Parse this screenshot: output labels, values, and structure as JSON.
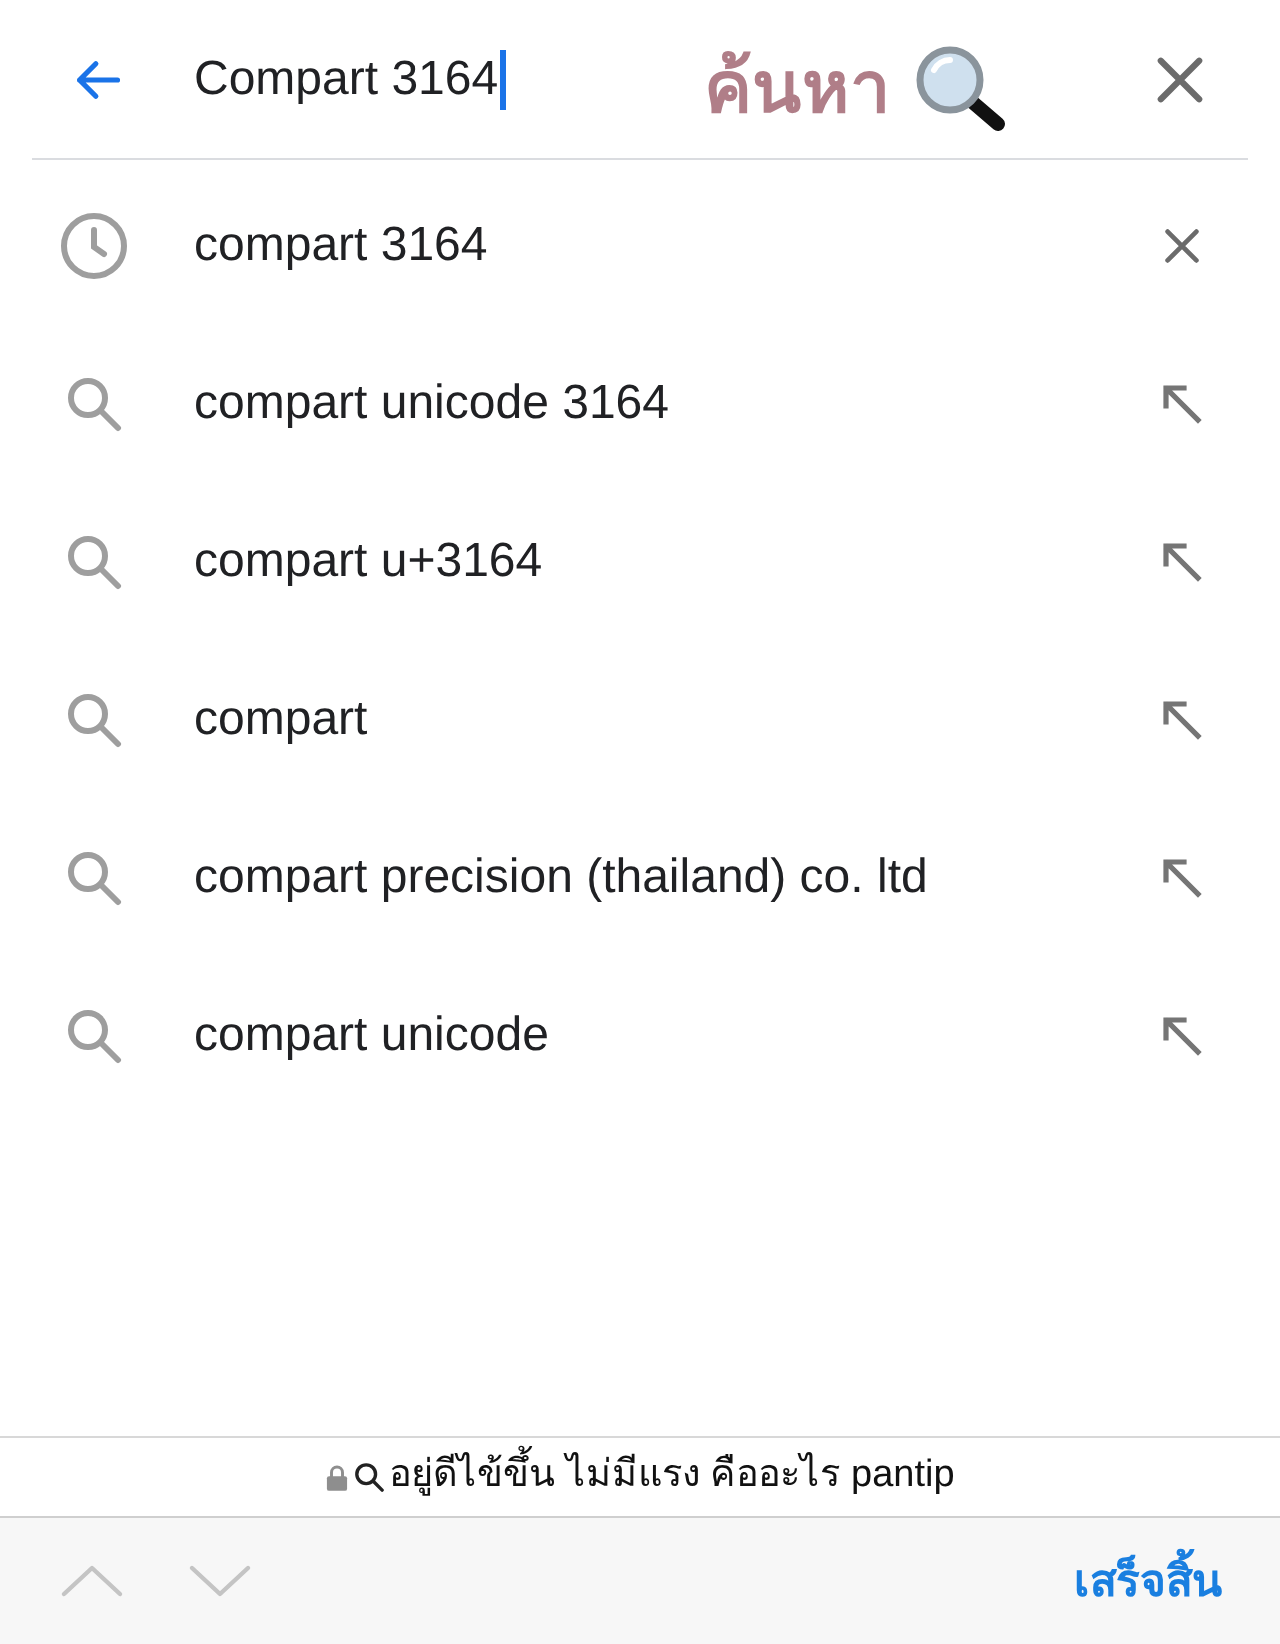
{
  "search_bar": {
    "value": "Compart 3164",
    "annotation": "ค้นหา"
  },
  "suggestions": [
    {
      "kind": "history",
      "text": "compart 3164"
    },
    {
      "kind": "suggestion",
      "text": "compart unicode 3164"
    },
    {
      "kind": "suggestion",
      "text": "compart u+3164"
    },
    {
      "kind": "suggestion",
      "text": "compart"
    },
    {
      "kind": "suggestion",
      "text": "compart precision (thailand) co. ltd"
    },
    {
      "kind": "suggestion",
      "text": "compart unicode"
    }
  ],
  "address_bar": {
    "secure": true,
    "text": "อยู่ดีไข้ขึ้น ไม่มีแรง คืออะไร pantip"
  },
  "toolbar": {
    "nav_buttons": [
      {
        "kind": "up",
        "disabled": true
      },
      {
        "kind": "down",
        "disabled": true
      }
    ],
    "done_label": "เสร็จสิ้น"
  }
}
